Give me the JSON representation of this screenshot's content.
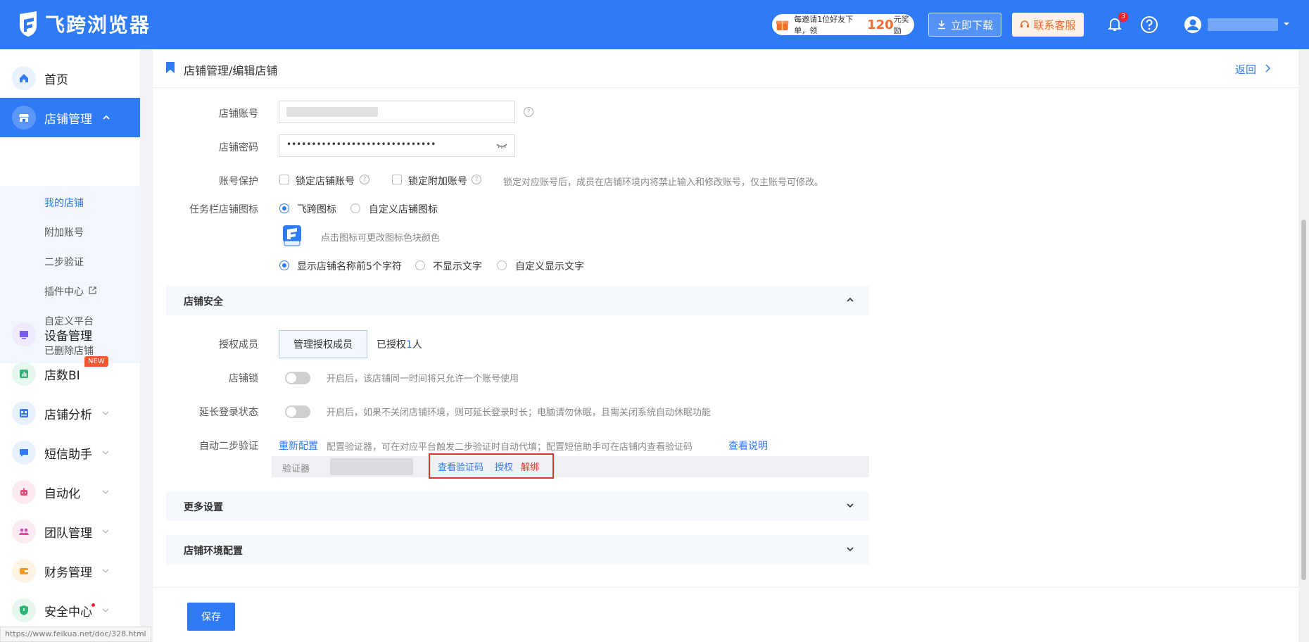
{
  "header": {
    "logo_text": "飞跨浏览器",
    "promo_prefix": "每邀请1位好友下单，领",
    "promo_amount": "120",
    "promo_suffix": "元奖励",
    "download_label": "立即下载",
    "support_label": "联系客服",
    "notification_count": "3"
  },
  "sidebar": {
    "items": [
      {
        "label": "首页",
        "icon": "home-icon"
      },
      {
        "label": "店铺管理",
        "icon": "shop-icon"
      },
      {
        "label": "设备管理",
        "icon": "device-icon"
      },
      {
        "label": "店数BI",
        "icon": "bi-chart-icon",
        "badge": "NEW"
      },
      {
        "label": "店铺分析",
        "icon": "analysis-icon"
      },
      {
        "label": "短信助手",
        "icon": "sms-icon"
      },
      {
        "label": "自动化",
        "icon": "robot-icon"
      },
      {
        "label": "团队管理",
        "icon": "team-icon"
      },
      {
        "label": "财务管理",
        "icon": "wallet-icon"
      },
      {
        "label": "安全中心",
        "icon": "shield-icon"
      }
    ],
    "sub_items": [
      "我的店铺",
      "附加账号",
      "二步验证",
      "插件中心",
      "自定义平台",
      "已删除店铺"
    ],
    "status_url": "https://www.feikua.net/doc/328.html"
  },
  "page": {
    "breadcrumb": "店铺管理/编辑店铺",
    "back_label": "返回",
    "store_account_label": "店铺账号",
    "store_password_label": "店铺密码",
    "store_password_value": "••••••••••••••••••••••••••••••",
    "account_protect_label": "账号保护",
    "lock_store_account": "锁定店铺账号",
    "lock_extra_account": "锁定附加账号",
    "lock_hint": "锁定对应账号后，成员在店铺环境内将禁止输入和修改账号，仅主账号可修改。",
    "taskbar_icon_label": "任务栏店铺图标",
    "icon_option_feikua": "飞跨图标",
    "icon_option_custom": "自定义店铺图标",
    "icon_change_hint": "点击图标可更改图标色块颜色",
    "text_option_first5": "显示店铺名称前5个字符",
    "text_option_none": "不显示文字",
    "text_option_custom": "自定义显示文字",
    "section_security": "店铺安全",
    "auth_members_label": "授权成员",
    "manage_members_btn": "管理授权成员",
    "authorized_prefix": "已授权",
    "authorized_count": "1",
    "authorized_suffix": "人",
    "store_lock_label": "店铺锁",
    "store_lock_hint": "开启后，该店铺同一时间将只允许一个账号使用",
    "extend_login_label": "延长登录状态",
    "extend_login_hint": "开启后，如果不关闭店铺环境，则可延长登录时长；电脑请勿休眠，且需关闭系统自动休眠功能",
    "auto_2fa_label": "自动二步验证",
    "reconfigure_link": "重新配置",
    "auto_2fa_hint": "配置验证器，可在对应平台触发二步验证时自动代填；配置短信助手可在店铺内查看验证码",
    "view_docs_link": "查看说明",
    "authenticator_label": "验证器",
    "view_code_link": "查看验证码",
    "authorize_link": "授权",
    "unbind_link": "解绑",
    "section_more": "更多设置",
    "section_env": "店铺环境配置",
    "save_label": "保存"
  },
  "colors": {
    "brand": "#2f7af5",
    "accent_orange": "#f36d2b",
    "danger": "#e5332a"
  }
}
